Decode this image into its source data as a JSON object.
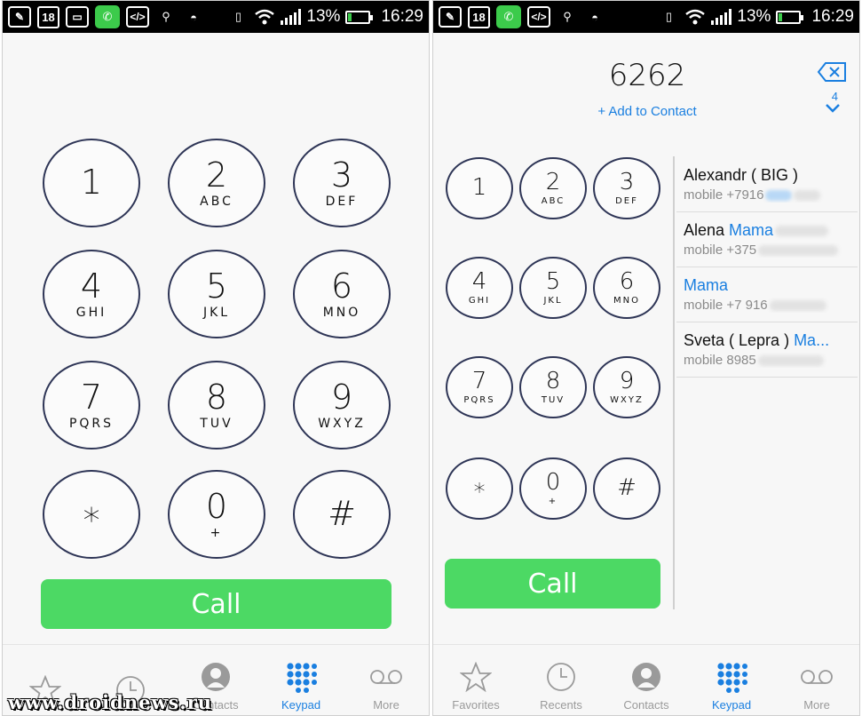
{
  "status_bar": {
    "calendar_day": "18",
    "battery_percent": "13%",
    "time": "16:29",
    "battery_level": 0.13,
    "signal_icon": "signal-bars-icon",
    "wifi_icon": "wifi-icon"
  },
  "keypad": {
    "keys": [
      {
        "digit": "1",
        "letters": ""
      },
      {
        "digit": "2",
        "letters": "ABC"
      },
      {
        "digit": "3",
        "letters": "DEF"
      },
      {
        "digit": "4",
        "letters": "GHI"
      },
      {
        "digit": "5",
        "letters": "JKL"
      },
      {
        "digit": "6",
        "letters": "MNO"
      },
      {
        "digit": "7",
        "letters": "PQRS"
      },
      {
        "digit": "8",
        "letters": "TUV"
      },
      {
        "digit": "9",
        "letters": "WXYZ"
      },
      {
        "digit": "∗",
        "letters": ""
      },
      {
        "digit": "0",
        "letters": "+"
      },
      {
        "digit": "#",
        "letters": ""
      }
    ],
    "call_label": "Call"
  },
  "tabs": [
    {
      "label": "Favorites",
      "icon": "star-icon"
    },
    {
      "label": "Recents",
      "icon": "clock-icon"
    },
    {
      "label": "Contacts",
      "icon": "person-icon"
    },
    {
      "label": "Keypad",
      "icon": "keypad-grid-icon"
    },
    {
      "label": "More",
      "icon": "voicemail-icon"
    }
  ],
  "left_tabs": [
    {
      "label": ""
    },
    {
      "label": ""
    },
    {
      "label": "Contacts"
    },
    {
      "label": "Keypad"
    },
    {
      "label": "More"
    }
  ],
  "dialer": {
    "number": "6262",
    "add_contact": "+ Add to Contact",
    "match_count": "4"
  },
  "results": [
    {
      "name_plain": "Alexandr ( BIG )",
      "name_hl": "",
      "name_rest": "",
      "phone_prefix": "mobile +7916"
    },
    {
      "name_plain": "Alena ",
      "name_hl": "Mama",
      "name_rest": "",
      "phone_prefix": "mobile +375"
    },
    {
      "name_plain": "",
      "name_hl": "Mama",
      "name_rest": "",
      "phone_prefix": "mobile +7 916"
    },
    {
      "name_plain": "Sveta ( Lepra ) ",
      "name_hl": "Ma...",
      "name_rest": "",
      "phone_prefix": "mobile 8985"
    }
  ],
  "watermark": "www.droidnews.ru",
  "colors": {
    "accent": "#1a7fe0",
    "call_green": "#4cd964",
    "key_border": "#2e3556"
  }
}
